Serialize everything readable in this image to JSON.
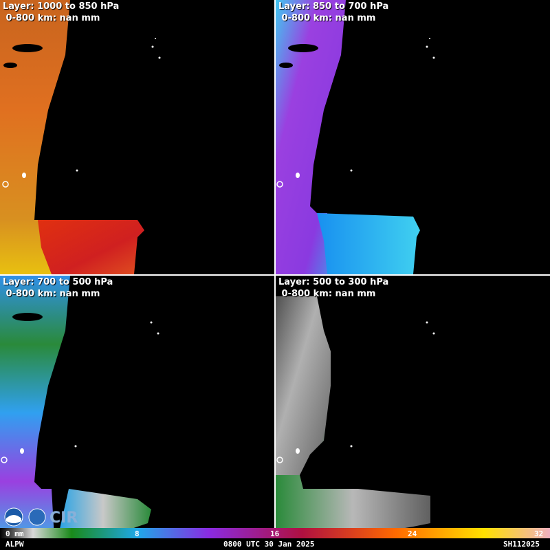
{
  "panels": [
    {
      "title": "Layer: 1000 to 850 hPa",
      "subtitle": " 0-800 km: nan mm"
    },
    {
      "title": "Layer: 850 to 700 hPa",
      "subtitle": " 0-800 km: nan mm"
    },
    {
      "title": "Layer: 700 to 500 hPa",
      "subtitle": " 0-800 km: nan mm"
    },
    {
      "title": "Layer: 500 to 300 hPa",
      "subtitle": " 0-800 km: nan mm"
    }
  ],
  "colorbar": {
    "ticks": [
      "0 mm",
      "8",
      "16",
      "24",
      "32"
    ],
    "colors": [
      "#000000",
      "#d8d8d8",
      "#1a8a1a",
      "#1fa8e8",
      "#8a2be2",
      "#b01040",
      "#ff6a00",
      "#ffe000",
      "#f0b0c0"
    ]
  },
  "footer": {
    "product": "ALPW",
    "time": "0800 UTC 30 Jan 2025",
    "storm": "SH112025"
  },
  "logos": [
    "noaa-logo",
    "cira-logo"
  ]
}
